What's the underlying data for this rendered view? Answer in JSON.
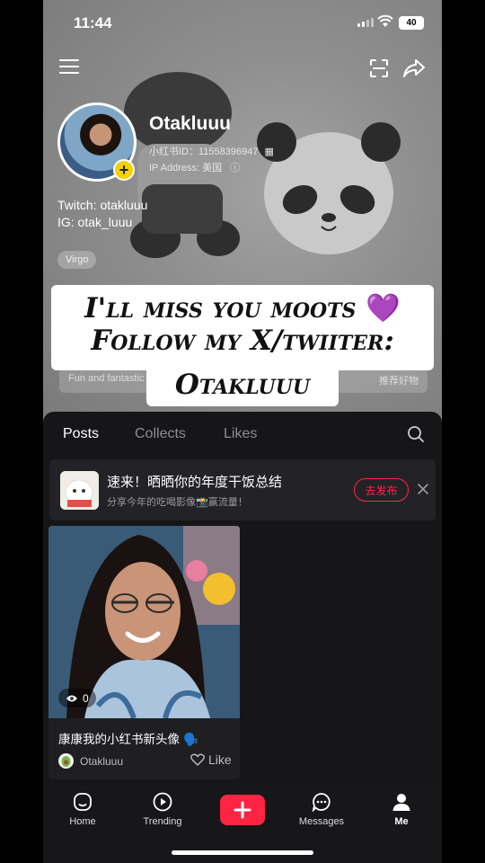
{
  "status": {
    "time": "11:44",
    "battery": "40"
  },
  "profile": {
    "name": "Otakluuu",
    "id_line": "小红书ID：11558396947",
    "ip_line": "IP Address: 美国",
    "bio_lines": [
      "Twitch: otakluuu",
      "IG: otak_luuu"
    ],
    "tag": "Virgo"
  },
  "overlay": {
    "line1": "I'll miss you moots",
    "heart": "💜",
    "line2": "Follow my X/twiiter:",
    "line3": "Otakluuu"
  },
  "features": {
    "left": "Fun and fantastic",
    "right": "推荐好物"
  },
  "tabs": [
    "Posts",
    "Collects",
    "Likes"
  ],
  "active_tab": "Posts",
  "promo": {
    "title": "速来！晒晒你的年度干饭总结",
    "subtitle": "分享今年的吃喝影像📸赢流量！",
    "button": "去发布"
  },
  "post": {
    "views": "0",
    "title": "康康我的小红书新头像 🗣️",
    "author": "Otakluuu",
    "like_label": "Like"
  },
  "nav": {
    "home": "Home",
    "trending": "Trending",
    "messages": "Messages",
    "me": "Me"
  },
  "colors": {
    "accent": "#ff2442",
    "badge": "#f5d100",
    "heart": "#9b4dd6"
  }
}
